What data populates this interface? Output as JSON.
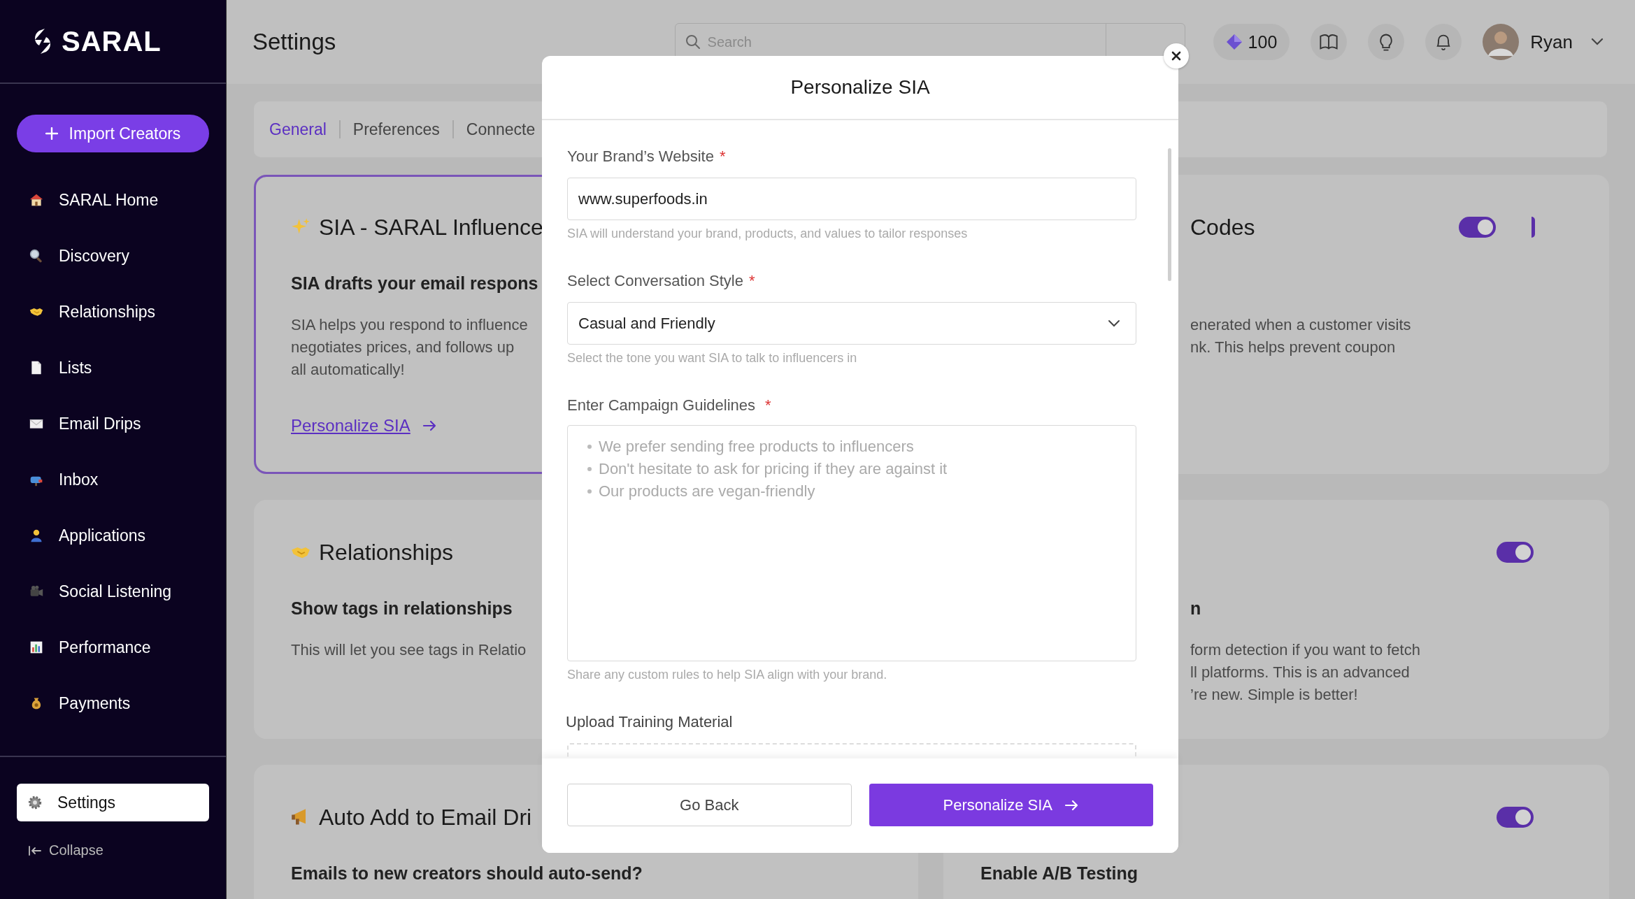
{
  "sidebar": {
    "logo": "SARAL",
    "import_button": "Import Creators",
    "items": [
      {
        "label": "SARAL Home",
        "selected": false
      },
      {
        "label": "Discovery",
        "selected": false
      },
      {
        "label": "Relationships",
        "selected": false
      },
      {
        "label": "Lists",
        "selected": false
      },
      {
        "label": "Email Drips",
        "selected": false
      },
      {
        "label": "Inbox",
        "selected": false
      },
      {
        "label": "Applications",
        "selected": false
      },
      {
        "label": "Social Listening",
        "selected": false
      },
      {
        "label": "Performance",
        "selected": false
      },
      {
        "label": "Payments",
        "selected": false
      }
    ],
    "settings": {
      "label": "Settings",
      "selected": true
    },
    "collapse": "Collapse"
  },
  "topbar": {
    "title": "Settings",
    "search": {
      "placeholder": "Search"
    },
    "credits": "100",
    "user": "Ryan"
  },
  "tabs": [
    {
      "label": "General",
      "selected": true
    },
    {
      "label": "Preferences",
      "selected": false
    },
    {
      "label": "Connecte",
      "selected": false
    }
  ],
  "cards": [
    {
      "left": {
        "highlighted": true,
        "title": "SIA - SARAL Influence",
        "subtitle": "SIA drafts your email respons",
        "body": [
          "SIA helps you respond to influence",
          "negotiates prices, and follows up",
          "all automatically!"
        ],
        "link": "Personalize SIA"
      },
      "right": {
        "title": "Codes",
        "body": [
          "enerated when a customer visits",
          "nk. This helps prevent coupon"
        ],
        "toggles": [
          {
            "kind": "full",
            "on": true
          },
          {
            "kind": "edge",
            "on": true
          }
        ]
      }
    },
    {
      "left": {
        "highlighted": false,
        "title": "Relationships",
        "subtitle": "Show tags in relationships",
        "body": [
          "This will let you see tags in Relatio"
        ]
      },
      "right": {
        "subtitle": "n",
        "body": [
          "form detection if you want to fetch",
          "ll platforms. This is an advanced",
          "’re new. Simple is better!"
        ],
        "toggles": [
          {
            "kind": "full",
            "on": true
          }
        ]
      }
    },
    {
      "left": {
        "highlighted": false,
        "title": "Auto Add to Email Dri",
        "subtitle": "Emails to new creators should auto-send?"
      },
      "right": {
        "subtitle": "Enable A/B Testing",
        "toggles": [
          {
            "kind": "full",
            "on": true
          }
        ]
      }
    }
  ],
  "modal": {
    "title": "Personalize SIA",
    "fields": [
      {
        "kind": "input",
        "label": "Your Brand’s Website",
        "required_mark": "*",
        "value": "www.superfoods.in",
        "help": "SIA will understand your brand, products, and values to tailor responses"
      },
      {
        "kind": "select",
        "label": "Select Conversation Style",
        "required_mark": "*",
        "value": "Casual and Friendly",
        "help": "Select the tone you want SIA to talk to influencers in"
      },
      {
        "kind": "textarea",
        "label": "Enter Campaign Guidelines",
        "required_mark": "*",
        "placeholder": [
          "We prefer sending free products to influencers",
          "Don't hesitate to ask for pricing if they are against it",
          "Our products are vegan-friendly"
        ],
        "help": "Share any custom rules to help SIA align with your brand."
      },
      {
        "kind": "upload",
        "label": "Upload Training Material"
      }
    ],
    "buttons": [
      {
        "kind": "secondary",
        "label": "Go Back"
      },
      {
        "kind": "primary",
        "label": "Personalize SIA"
      }
    ]
  }
}
